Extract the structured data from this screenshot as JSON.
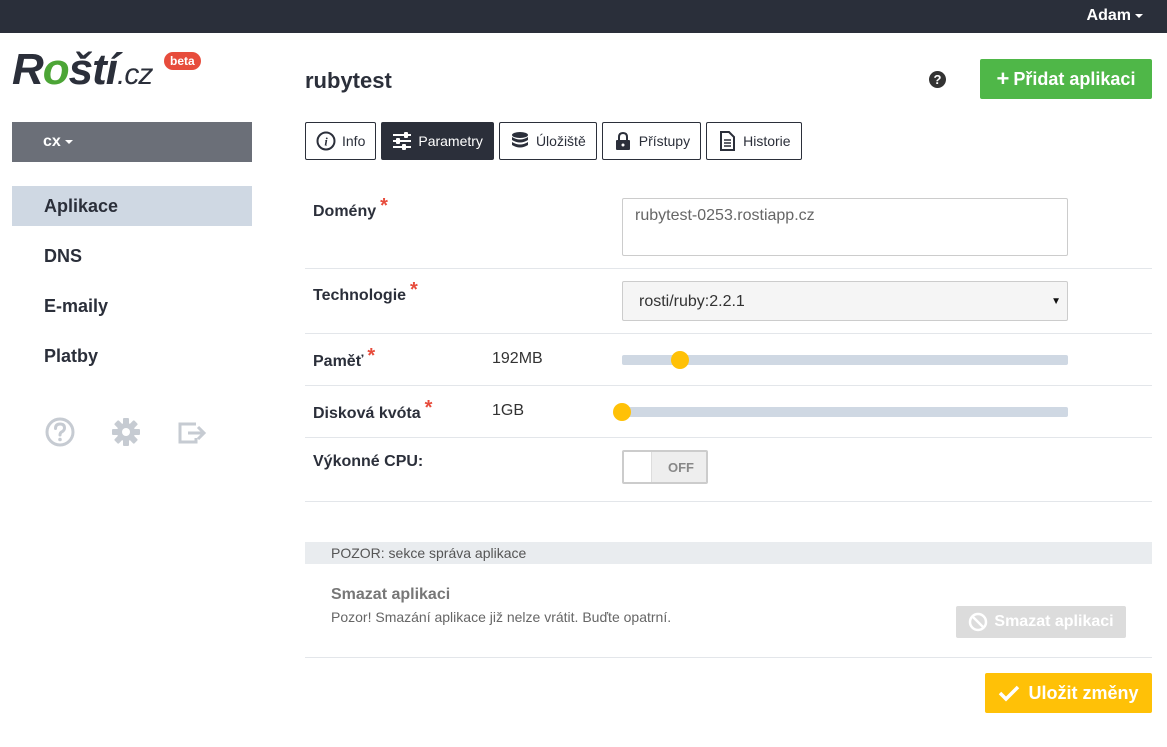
{
  "topbar": {
    "user_label": "Adam"
  },
  "logo": {
    "text_r": "R",
    "text_o": "o",
    "text_rest": "ští",
    "text_cz": ".cz",
    "badge": "beta"
  },
  "sidebar": {
    "org_label": "cx",
    "items": [
      {
        "label": "Aplikace",
        "active": true
      },
      {
        "label": "DNS",
        "active": false
      },
      {
        "label": "E-maily",
        "active": false
      },
      {
        "label": "Platby",
        "active": false
      }
    ],
    "icons": [
      "help-circle-icon",
      "gear-icon",
      "logout-icon"
    ]
  },
  "header": {
    "title": "rubytest",
    "add_button_label": "Přidat aplikaci"
  },
  "tabs": [
    {
      "label": "Info",
      "icon": "info-icon"
    },
    {
      "label": "Parametry",
      "icon": "sliders-icon",
      "active": true
    },
    {
      "label": "Úložiště",
      "icon": "database-icon"
    },
    {
      "label": "Přístupy",
      "icon": "lock-icon"
    },
    {
      "label": "Historie",
      "icon": "document-icon"
    }
  ],
  "form": {
    "domains": {
      "label": "Domény",
      "required_mark": "*",
      "value": "rubytest-0253.rostiapp.cz"
    },
    "technology": {
      "label": "Technologie",
      "required_mark": "*",
      "value": "rosti/ruby:2.2.1"
    },
    "memory": {
      "label": "Paměť",
      "required_mark": "*",
      "value": "192MB",
      "level": 0.13
    },
    "disk": {
      "label": "Disková kvóta",
      "required_mark": "*",
      "value": "1GB",
      "level": 0.0
    },
    "cpu": {
      "label": "Výkonné CPU:",
      "toggle_state": "OFF"
    }
  },
  "danger": {
    "header": "POZOR: sekce správa aplikace",
    "title": "Smazat aplikaci",
    "text": "Pozor! Smazání aplikace již nelze vrátit. Buďte opatrní.",
    "button_label": "Smazat aplikaci"
  },
  "save_label": "Uložit změny",
  "colors": {
    "primary_green": "#4fb748",
    "accent_yellow": "#ffc107",
    "dark": "#2b2f3a",
    "required": "#e74c3c"
  }
}
